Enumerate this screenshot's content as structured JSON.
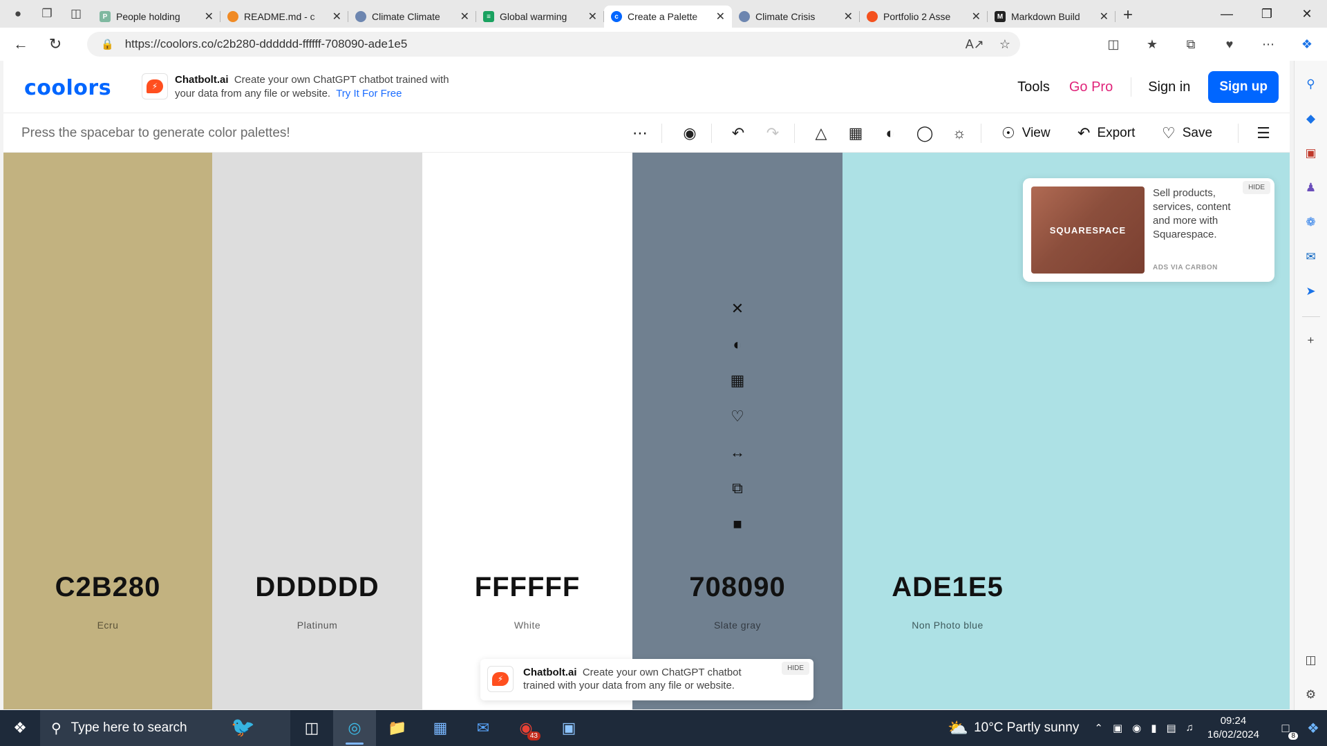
{
  "browser": {
    "tabs": [
      {
        "title": "People holding",
        "favicon_color": "#7fb8a0",
        "active": false
      },
      {
        "title": "README.md - c",
        "favicon_color": "#f08a24",
        "active": false
      },
      {
        "title": "Climate Climate",
        "favicon_color": "#6d86b0",
        "active": false
      },
      {
        "title": "Global warming",
        "favicon_color": "#1aa260",
        "active": false
      },
      {
        "title": "Create a Palette",
        "favicon_color": "#0066ff",
        "active": true
      },
      {
        "title": "Climate Crisis",
        "favicon_color": "#6d86b0",
        "active": false
      },
      {
        "title": "Portfolio 2 Asse",
        "favicon_color": "#f4511e",
        "active": false
      },
      {
        "title": "Markdown Build",
        "favicon_color": "#222222",
        "active": false
      }
    ],
    "url": "https://coolors.co/c2b280-dddddd-ffffff-708090-ade1e5"
  },
  "header": {
    "logo": "coolors",
    "promo": {
      "brand": "Chatbolt.ai",
      "text": "Create your own ChatGPT chatbot trained with your data from any file or website.",
      "cta": "Try It For Free"
    },
    "nav": {
      "tools": "Tools",
      "gopro": "Go Pro",
      "signin": "Sign in",
      "signup": "Sign up"
    }
  },
  "toolbar": {
    "hint": "Press the spacebar to generate color palettes!",
    "view_label": "View",
    "export_label": "Export",
    "save_label": "Save"
  },
  "palette": [
    {
      "hex": "C2B280",
      "name": "Ecru",
      "bg": "#C2B280",
      "text_color": "#111111",
      "name_color": "#5a5238"
    },
    {
      "hex": "DDDDDD",
      "name": "Platinum",
      "bg": "#DDDDDD",
      "text_color": "#111111",
      "name_color": "#555555"
    },
    {
      "hex": "FFFFFF",
      "name": "White",
      "bg": "#FFFFFF",
      "text_color": "#111111",
      "name_color": "#666666"
    },
    {
      "hex": "708090",
      "name": "Slate gray",
      "bg": "#708090",
      "text_color": "#111111",
      "name_color": "#333a42"
    },
    {
      "hex": "ADE1E5",
      "name": "Non Photo blue",
      "bg": "#ADE1E5",
      "text_color": "#111111",
      "name_color": "#3e5a5c"
    }
  ],
  "ad_carbon": {
    "image_text": "SQUARESPACE",
    "copy": "Sell products, services, content and more with Squarespace.",
    "via": "ADS VIA CARBON",
    "hide": "HIDE"
  },
  "ad_bottom": {
    "brand": "Chatbolt.ai",
    "copy": "Create your own ChatGPT chatbot trained with your data from any file or website.",
    "hide": "HIDE"
  },
  "taskbar": {
    "search_placeholder": "Type here to search",
    "weather": "10°C  Partly sunny",
    "time": "09:24",
    "date": "16/02/2024",
    "notification_count": "8",
    "chrome_badge": "43"
  }
}
